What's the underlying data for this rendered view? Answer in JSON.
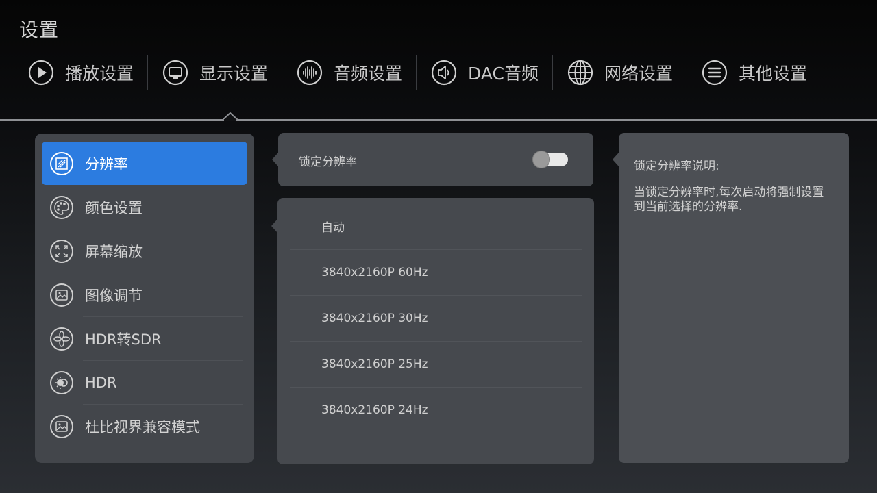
{
  "header": {
    "title": "设置"
  },
  "top_tabs": [
    {
      "label": "播放设置",
      "icon": "play-icon"
    },
    {
      "label": "显示设置",
      "icon": "monitor-icon",
      "active": true
    },
    {
      "label": "音频设置",
      "icon": "audio-wave-icon"
    },
    {
      "label": "DAC音频",
      "icon": "speaker-icon"
    },
    {
      "label": "网络设置",
      "icon": "globe-icon"
    },
    {
      "label": "其他设置",
      "icon": "menu-icon"
    }
  ],
  "side_menu": [
    {
      "label": "分辨率",
      "icon": "resolution-icon",
      "active": true
    },
    {
      "label": "颜色设置",
      "icon": "palette-icon"
    },
    {
      "label": "屏幕缩放",
      "icon": "screen-scale-icon"
    },
    {
      "label": "图像调节",
      "icon": "image-adjust-icon"
    },
    {
      "label": "HDR转SDR",
      "icon": "hdr-convert-icon"
    },
    {
      "label": "HDR",
      "icon": "hdr-icon"
    },
    {
      "label": "杜比视界兼容模式",
      "icon": "dolby-vision-icon"
    }
  ],
  "lock_resolution": {
    "label": "锁定分辨率",
    "enabled": false
  },
  "resolutions": [
    "自动",
    "3840x2160P  60Hz",
    "3840x2160P  30Hz",
    "3840x2160P  25Hz",
    "3840x2160P  24Hz"
  ],
  "info": {
    "title": "锁定分辨率说明:",
    "text": "当锁定分辨率时,每次启动将强制设置到当前选择的分辨率."
  },
  "colors": {
    "accent": "#2c7ce0",
    "panel": "#43464b"
  }
}
